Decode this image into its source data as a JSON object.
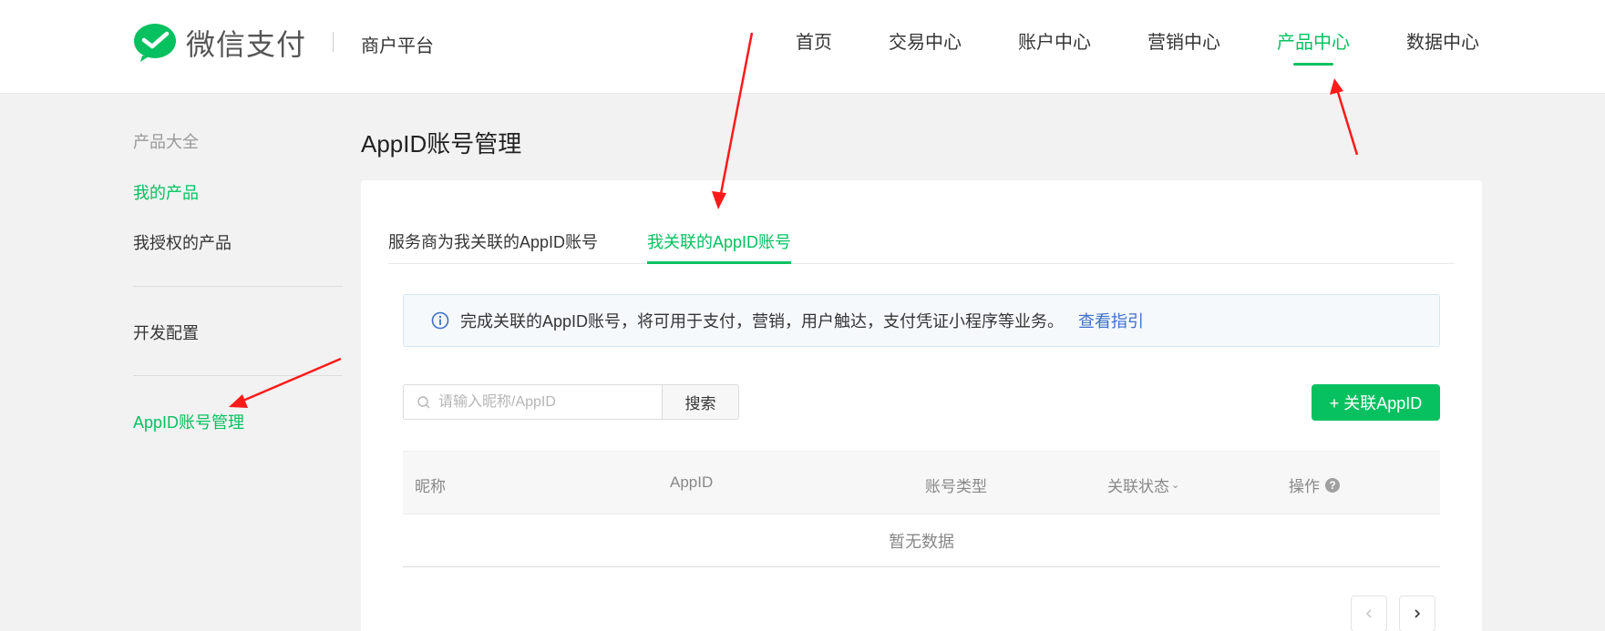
{
  "header": {
    "logo_text": "微信支付",
    "platform": "商户平台",
    "nav": [
      {
        "label": "首页",
        "active": false
      },
      {
        "label": "交易中心",
        "active": false
      },
      {
        "label": "账户中心",
        "active": false
      },
      {
        "label": "营销中心",
        "active": false
      },
      {
        "label": "产品中心",
        "active": true
      },
      {
        "label": "数据中心",
        "active": false
      }
    ]
  },
  "sidebar": {
    "group_label": "产品大全",
    "items": [
      {
        "label": "我的产品",
        "active": true
      },
      {
        "label": "我授权的产品",
        "active": false
      },
      {
        "label": "开发配置",
        "active": false
      },
      {
        "label": "AppID账号管理",
        "active": true
      }
    ]
  },
  "main": {
    "title": "AppID账号管理",
    "tabs": [
      {
        "label": "服务商为我关联的AppID账号",
        "active": false
      },
      {
        "label": "我关联的AppID账号",
        "active": true
      }
    ],
    "notice": {
      "text": "完成关联的AppID账号，将可用于支付，营销，用户触达，支付凭证小程序等业务。",
      "link": "查看指引"
    },
    "search": {
      "placeholder": "请输入昵称/AppID",
      "value": "",
      "button_label": "搜索"
    },
    "add_button_label": "+ 关联AppID",
    "table": {
      "columns": [
        "昵称",
        "AppID",
        "账号类型",
        "关联状态",
        "操作"
      ],
      "empty_text": "暂无数据"
    }
  },
  "colors": {
    "accent": "#07c160",
    "link": "#3e70c8",
    "annotation_arrow": "#ff1a1a"
  }
}
